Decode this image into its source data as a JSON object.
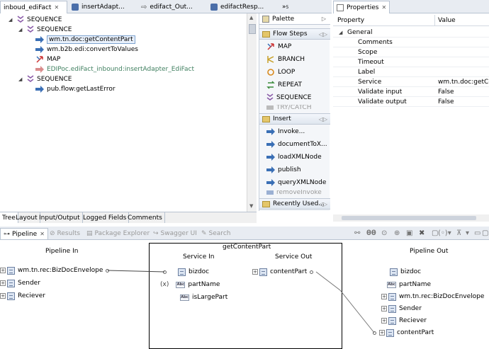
{
  "editor_tabs": [
    {
      "label": "inboud_ediFact",
      "active": true
    },
    {
      "label": "insertAdapt..."
    },
    {
      "label": "edifact_Out..."
    },
    {
      "label": "edifactResp..."
    },
    {
      "label": "»",
      "count": "5"
    }
  ],
  "flow_tree": {
    "items": [
      {
        "label": "SEQUENCE",
        "icon": "sequence-icon"
      },
      {
        "label": "SEQUENCE",
        "icon": "sequence-icon"
      },
      {
        "label": "wm.tn.doc:getContentPart",
        "icon": "invoke-icon",
        "selected": true
      },
      {
        "label": "wm.b2b.edi:convertToValues",
        "icon": "invoke-icon"
      },
      {
        "label": "MAP",
        "icon": "map-icon"
      },
      {
        "label": "EDIPoc.ediFact_inbound:insertAdapter_EdiFact",
        "icon": "invoke-icon",
        "disabled": true
      },
      {
        "label": "SEQUENCE",
        "icon": "sequence-icon"
      },
      {
        "label": "pub.flow:getLastError",
        "icon": "invoke-icon"
      }
    ]
  },
  "palette": {
    "title": "Palette",
    "flow_steps_header": "Flow Steps",
    "flow_steps": [
      "MAP",
      "BRANCH",
      "LOOP",
      "REPEAT",
      "SEQUENCE",
      "TRY/CATCH"
    ],
    "insert_header": "Insert",
    "insert_items": [
      "Invoke...",
      "documentToX...",
      "loadXMLNode",
      "publish",
      "queryXMLNode",
      "removeInvoke"
    ],
    "recent_header": "Recently Used..."
  },
  "bottom_tabs": [
    "Tree",
    "Layout",
    "Input/Output",
    "Logged Fields",
    "Comments"
  ],
  "properties": {
    "tab_label": "Properties",
    "col_property": "Property",
    "col_value": "Value",
    "group": "General",
    "rows": [
      {
        "name": "Comments",
        "value": ""
      },
      {
        "name": "Scope",
        "value": ""
      },
      {
        "name": "Timeout",
        "value": ""
      },
      {
        "name": "Label",
        "value": ""
      },
      {
        "name": "Service",
        "value": "wm.tn.doc:getCo"
      },
      {
        "name": "Validate input",
        "value": "False"
      },
      {
        "name": "Validate output",
        "value": "False"
      }
    ]
  },
  "pipeline_tabs": [
    {
      "label": "Pipeline",
      "active": true
    },
    {
      "label": "Results"
    },
    {
      "label": "Package Explorer"
    },
    {
      "label": "Swagger UI"
    },
    {
      "label": "Search"
    }
  ],
  "pipeline": {
    "in_title": "Pipeline In",
    "service_title": "getContentPart",
    "service_in_title": "Service In",
    "service_out_title": "Service Out",
    "out_title": "Pipeline Out",
    "pipeline_in": [
      {
        "label": "wm.tn.rec:BizDocEnvelope",
        "type": "document"
      },
      {
        "label": "Sender",
        "type": "document"
      },
      {
        "label": "Reciever",
        "type": "document"
      }
    ],
    "service_in": [
      {
        "label": "bizdoc",
        "type": "document"
      },
      {
        "label": "partName",
        "type": "string"
      },
      {
        "label": "isLargePart",
        "type": "string"
      }
    ],
    "service_out": [
      {
        "label": "contentPart",
        "type": "document"
      }
    ],
    "pipeline_out": [
      {
        "label": "bizdoc",
        "type": "document"
      },
      {
        "label": "partName",
        "type": "string"
      },
      {
        "label": "wm.tn.rec:BizDocEnvelope",
        "type": "document"
      },
      {
        "label": "Sender",
        "type": "document"
      },
      {
        "label": "Reciever",
        "type": "document"
      },
      {
        "label": "contentPart",
        "type": "document"
      }
    ],
    "string_icon_text": "Abc"
  },
  "colors": {
    "accent": "#7da2ce",
    "tab_bg": "#e8ecf2",
    "disabled_text": "#3f7f5f"
  }
}
